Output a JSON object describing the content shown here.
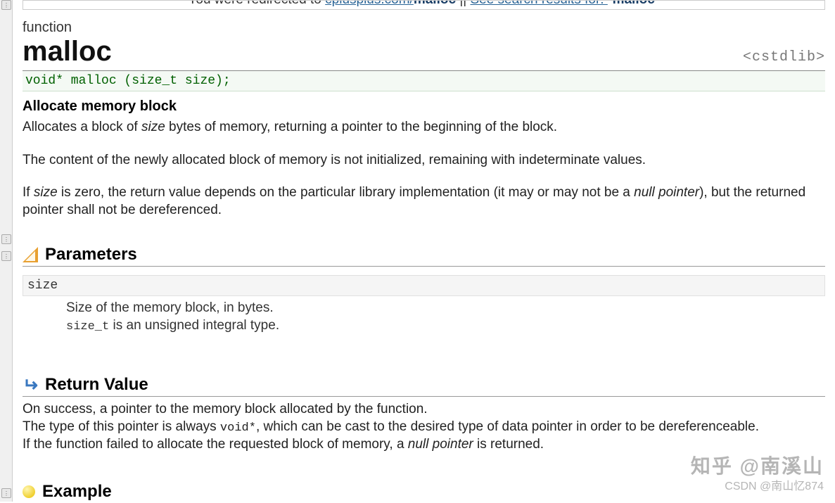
{
  "redirect": {
    "prefix": "You were redirected to ",
    "link1": "cplusplus.com/",
    "link1bold": "malloc",
    "mid": " || ",
    "link2": "See search results for: ",
    "quote_open": "\"",
    "term": "malloc",
    "quote_close": "\""
  },
  "header": {
    "type_label": "function",
    "title": "malloc",
    "include": "<cstdlib>"
  },
  "signature": "void* malloc (size_t size);",
  "subhead": "Allocate memory block",
  "p1_a": "Allocates a block of ",
  "p1_size": "size",
  "p1_b": " bytes of memory, returning a pointer to the beginning of the block.",
  "p2": "The content of the newly allocated block of memory is not initialized, remaining with indeterminate values.",
  "p3_a": "If ",
  "p3_size": "size",
  "p3_b": " is zero, the return value depends on the particular library implementation (it may or may not be a ",
  "p3_null": "null pointer",
  "p3_c": "), but the returned pointer shall not be dereferenced.",
  "sections": {
    "parameters": "Parameters",
    "return_value": "Return Value",
    "example": "Example"
  },
  "param": {
    "name": "size",
    "desc1": "Size of the memory block, in bytes.",
    "desc2a": "size_t",
    "desc2b": " is an unsigned integral type."
  },
  "ret": {
    "p1": "On success, a pointer to the memory block allocated by the function.",
    "p2a": "The type of this pointer is always ",
    "p2mono": "void*",
    "p2b": ", which can be cast to the desired type of data pointer in order to be dereferenceable.",
    "p3a": "If the function failed to allocate the requested block of memory, a ",
    "p3null": "null pointer",
    "p3b": " is returned."
  },
  "watermark1": "知乎 @南溪山",
  "watermark2": "CSDN @南山忆874"
}
